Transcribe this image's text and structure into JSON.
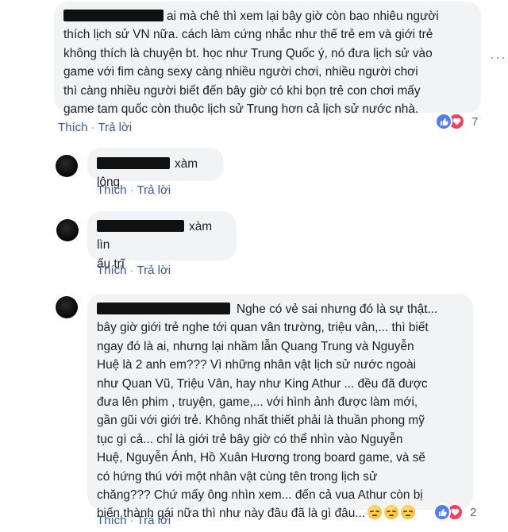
{
  "comments": [
    {
      "text_lines": [
        "ai mà chê thì xem lại bây giờ còn bao nhiêu người",
        "thích lịch sử VN nữa. cách làm cứng nhắc như thế trẻ em và giới trẻ",
        "không thích là chuyện bt. học như Trung Quốc ý, nó đưa lịch sử vào",
        "game với fim càng sexy càng nhiều người chơi, nhiều người chơi",
        "thì càng nhiều người biết đến bây giờ có khi bọn trẻ con chơi mấy",
        "game tam quốc còn thuộc lịch sử Trung hơn cả lịch sử nước nhà."
      ],
      "like_label": "Thích",
      "reply_label": "Trả lời",
      "reaction_count": "7"
    },
    {
      "text_lines": [
        "xàm lông"
      ],
      "like_label": "Thích",
      "reply_label": "Trả lời"
    },
    {
      "text_lines": [
        "xàm lìn",
        "ấu trĩ"
      ],
      "like_label": "Thích",
      "reply_label": "Trả lời"
    },
    {
      "text_lines": [
        "Nghe có vẻ sai nhưng đó là sự thật...",
        "bây giờ giới trẻ nghe tới quan vân trường, triệu vân,... thì biết",
        "ngay đó là ai, nhưng lại nhầm lẫn Quang Trung và Nguyễn",
        "Huệ là 2 anh em??? Vì những nhân vật lịch sử nước ngoài",
        "như Quan Vũ, Triệu Vân, hay như King Athur ... đều đã được",
        "đưa lên phim , truyện, game,... với hình ảnh được làm mới,",
        "gần gũi với giới trẻ. Không nhất thiết phải là thuần phong mỹ",
        "tục gì cả... chỉ là giới trẻ bây giờ có thể nhìn vào Nguyễn",
        "Huệ, Nguyễn Ánh, Hồ Xuân Hương trong board game, và sẽ",
        "có hứng thú với một nhân vật cùng tên trong lịch sử",
        "chăng??? Chứ mấy ông nhìn xem... đến cả vua Athur còn bị",
        "biến thành gái nữa thì như này đâu đã là gì đâu..."
      ],
      "like_label": "Thích",
      "reply_label": "Trả lời",
      "reaction_count": "2"
    }
  ],
  "more_icon": "···",
  "icons": {
    "like": "like-reaction-icon",
    "love": "love-reaction-icon",
    "emoji": "relieved-face-emoji"
  },
  "colors": {
    "link": "#385898",
    "bubble": "#f2f3f5",
    "like": "#4f7ef2",
    "love": "#f0415c"
  }
}
